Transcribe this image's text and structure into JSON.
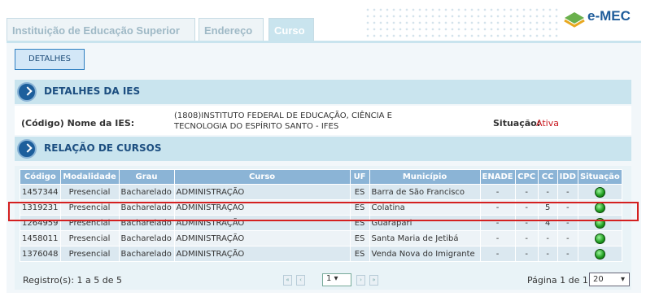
{
  "tabs": [
    {
      "label": "Instituição de Educação Superior"
    },
    {
      "label": "Endereço"
    },
    {
      "label": "Curso"
    }
  ],
  "logo": {
    "text": "e-MEC",
    "icon": "emec-logo-icon"
  },
  "button_detalhes": "DETALHES",
  "section_ies": {
    "title": "DETALHES DA IES"
  },
  "ies": {
    "key_label": "(Código) Nome da IES:",
    "value": "(1808)INSTITUTO FEDERAL DE EDUCAÇÃO, CIÊNCIA E TECNOLOGIA DO ESPÍRITO SANTO - IFES",
    "situacao_label": "Situação:",
    "situacao_value": "Ativa"
  },
  "section_cursos": {
    "title": "RELAÇÃO DE CURSOS"
  },
  "table": {
    "headers": [
      "Código",
      "Modalidade",
      "Grau",
      "Curso",
      "UF",
      "Município",
      "ENADE",
      "CPC",
      "CC",
      "IDD",
      "Situação"
    ],
    "rows": [
      {
        "codigo": "1457344",
        "modalidade": "Presencial",
        "grau": "Bacharelado",
        "curso": "ADMINISTRAÇÃO",
        "uf": "ES",
        "municipio": "Barra de São Francisco",
        "enade": "-",
        "cpc": "-",
        "cc": "-",
        "idd": "-"
      },
      {
        "codigo": "1319231",
        "modalidade": "Presencial",
        "grau": "Bacharelado",
        "curso": "ADMINISTRAÇÃO",
        "uf": "ES",
        "municipio": "Colatina",
        "enade": "-",
        "cpc": "-",
        "cc": "5",
        "idd": "-"
      },
      {
        "codigo": "1264959",
        "modalidade": "Presencial",
        "grau": "Bacharelado",
        "curso": "ADMINISTRAÇÃO",
        "uf": "ES",
        "municipio": "Guarapari",
        "enade": "-",
        "cpc": "-",
        "cc": "4",
        "idd": "-"
      },
      {
        "codigo": "1458011",
        "modalidade": "Presencial",
        "grau": "Bacharelado",
        "curso": "ADMINISTRAÇÃO",
        "uf": "ES",
        "municipio": "Santa Maria de Jetibá",
        "enade": "-",
        "cpc": "-",
        "cc": "-",
        "idd": "-"
      },
      {
        "codigo": "1376048",
        "modalidade": "Presencial",
        "grau": "Bacharelado",
        "curso": "ADMINISTRAÇÃO",
        "uf": "ES",
        "municipio": "Venda Nova do Imigrante",
        "enade": "-",
        "cpc": "-",
        "cc": "-",
        "idd": "-"
      }
    ]
  },
  "footer": {
    "registros": "Registro(s): 1 a 5 de 5",
    "page_select": "1",
    "pagina": "Página 1 de 1",
    "per_page": "20"
  },
  "colors": {
    "header_bg": "#8bb4d6",
    "section_bg": "#c9e4ee",
    "status_red": "#c8161d",
    "highlight": "#d42020"
  }
}
